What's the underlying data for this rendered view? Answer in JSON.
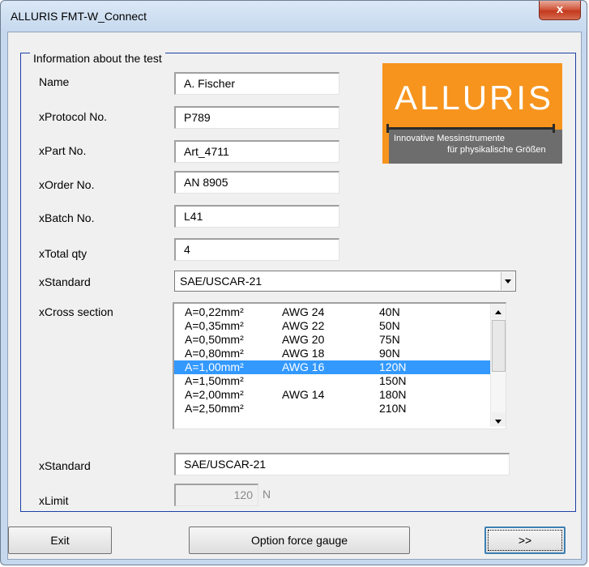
{
  "window": {
    "title": "ALLURIS FMT-W_Connect",
    "close_label": "x"
  },
  "group": {
    "title": "Information about the test"
  },
  "logo": {
    "brand": "ALLURIS",
    "tagline1": "Innovative Messinstrumente",
    "tagline2": "für physikalische Größen",
    "colors": {
      "orange": "#f7941d",
      "grey": "#6d6d6d"
    }
  },
  "fields": {
    "name": {
      "label": "Name",
      "value": "A. Fischer"
    },
    "protocol": {
      "label": "xProtocol No.",
      "value": "P789"
    },
    "part": {
      "label": "xPart No.",
      "value": "Art_4711"
    },
    "order": {
      "label": "xOrder No.",
      "value": "AN 8905"
    },
    "batch": {
      "label": "xBatch No.",
      "value": "L41"
    },
    "total": {
      "label": "xTotal qty",
      "value": "4"
    }
  },
  "standard_select": {
    "label": "xStandard",
    "value": "SAE/USCAR-21"
  },
  "cross_section": {
    "label": "xCross section",
    "rows": [
      {
        "area": "A=0,22mm²",
        "awg": "AWG 24",
        "force": "40N",
        "selected": false
      },
      {
        "area": "A=0,35mm²",
        "awg": "AWG 22",
        "force": "50N",
        "selected": false
      },
      {
        "area": "A=0,50mm²",
        "awg": "AWG 20",
        "force": "75N",
        "selected": false
      },
      {
        "area": "A=0,80mm²",
        "awg": "AWG 18",
        "force": "90N",
        "selected": false
      },
      {
        "area": "A=1,00mm²",
        "awg": "AWG 16",
        "force": "120N",
        "selected": true
      },
      {
        "area": "A=1,50mm²",
        "awg": "",
        "force": "150N",
        "selected": false
      },
      {
        "area": "A=2,00mm²",
        "awg": "AWG 14",
        "force": "180N",
        "selected": false
      },
      {
        "area": "A=2,50mm²",
        "awg": "",
        "force": "210N",
        "selected": false
      }
    ],
    "selection_color": "#3399ff"
  },
  "standard_display": {
    "label": "xStandard",
    "value": "SAE/USCAR-21"
  },
  "limit": {
    "label": "xLimit",
    "value": "120",
    "unit": "N"
  },
  "buttons": {
    "exit": "Exit",
    "option": "Option force gauge",
    "next": ">>"
  }
}
